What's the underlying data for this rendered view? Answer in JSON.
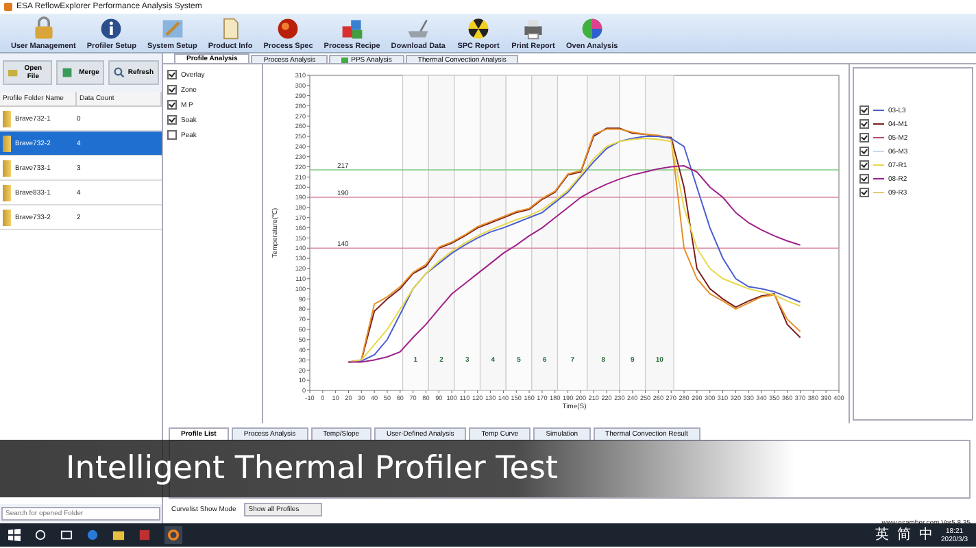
{
  "window": {
    "title": "ESA ReflowExplorer Performance Analysis System"
  },
  "toolbar": [
    "User Management",
    "Profiler Setup",
    "System Setup",
    "Product Info",
    "Process Spec",
    "Process Recipe",
    "Download Data",
    "SPC Report",
    "Print Report",
    "Oven  Analysis"
  ],
  "left_panel": {
    "buttons": [
      "Open File",
      "Merge",
      "Refresh"
    ],
    "table": {
      "columns": [
        "Profile Folder Name",
        "Data Count"
      ],
      "rows": [
        {
          "name": "Brave732-1",
          "count": "0",
          "selected": false
        },
        {
          "name": "Brave732-2",
          "count": "4",
          "selected": true
        },
        {
          "name": "Brave733-1",
          "count": "3",
          "selected": false
        },
        {
          "name": "Brave833-1",
          "count": "4",
          "selected": false
        },
        {
          "name": "Brave733-2",
          "count": "2",
          "selected": false
        }
      ]
    },
    "search": {
      "placeholder": "Search for opened Folder"
    }
  },
  "analysis_tabs": [
    {
      "label": "Profile Analysis",
      "selected": true
    },
    {
      "label": "Process Analysis",
      "selected": false
    },
    {
      "label": "PPS Analysis",
      "selected": false
    },
    {
      "label": "Thermal Convection Analysis",
      "selected": false
    }
  ],
  "options": [
    {
      "label": "Overlay",
      "checked": true
    },
    {
      "label": "Zone",
      "checked": true
    },
    {
      "label": "M P",
      "checked": true
    },
    {
      "label": "Soak",
      "checked": true
    },
    {
      "label": "Peak",
      "checked": false
    }
  ],
  "chart": {
    "chart_data": {
      "type": "line",
      "xlabel": "Time(S)",
      "ylabel": "Temperature(℃)",
      "xlim": [
        -10,
        400
      ],
      "ylim": [
        0,
        310
      ],
      "xticks": [
        -10,
        0,
        10,
        20,
        30,
        40,
        50,
        60,
        70,
        80,
        90,
        100,
        110,
        120,
        130,
        140,
        150,
        160,
        170,
        180,
        190,
        200,
        210,
        220,
        230,
        240,
        250,
        260,
        270,
        280,
        290,
        300,
        310,
        320,
        330,
        340,
        350,
        360,
        370,
        380,
        390,
        400
      ],
      "yticks": [
        0,
        10,
        20,
        30,
        40,
        50,
        60,
        70,
        80,
        90,
        100,
        110,
        120,
        130,
        140,
        150,
        160,
        170,
        180,
        190,
        200,
        210,
        220,
        230,
        240,
        250,
        260,
        270,
        280,
        290,
        300,
        310
      ],
      "x": [
        20,
        30,
        40,
        50,
        60,
        70,
        80,
        90,
        100,
        110,
        120,
        130,
        140,
        150,
        160,
        170,
        180,
        190,
        200,
        210,
        220,
        230,
        240,
        250,
        260,
        270,
        280,
        290,
        300,
        310,
        320,
        330,
        340,
        350,
        360,
        370
      ],
      "series": [
        {
          "color": "#7a1f1f",
          "values": [
            28,
            30,
            78,
            90,
            100,
            115,
            122,
            140,
            145,
            152,
            160,
            165,
            170,
            175,
            178,
            188,
            195,
            212,
            215,
            250,
            258,
            258,
            253,
            252,
            250,
            249,
            200,
            120,
            100,
            90,
            82,
            88,
            93,
            95,
            65,
            52
          ]
        },
        {
          "color": "#e8902a",
          "values": [
            null,
            31,
            85,
            92,
            102,
            116,
            124,
            141,
            146,
            153,
            161,
            166,
            171,
            176,
            179,
            189,
            196,
            213,
            216,
            252,
            257,
            257,
            254,
            252,
            251,
            248,
            140,
            110,
            95,
            88,
            80,
            86,
            92,
            94,
            70,
            58
          ]
        },
        {
          "color": "#4a5fd0",
          "values": [
            28,
            29,
            35,
            50,
            75,
            100,
            115,
            125,
            135,
            143,
            150,
            156,
            160,
            165,
            170,
            175,
            185,
            195,
            210,
            225,
            238,
            245,
            248,
            250,
            250,
            248,
            240,
            200,
            160,
            130,
            110,
            102,
            100,
            97,
            92,
            87
          ]
        },
        {
          "color": "#e8d84a",
          "values": [
            28,
            30,
            45,
            60,
            80,
            100,
            115,
            127,
            137,
            145,
            152,
            158,
            163,
            168,
            172,
            178,
            187,
            197,
            212,
            228,
            240,
            245,
            247,
            248,
            247,
            245,
            180,
            140,
            120,
            110,
            105,
            100,
            97,
            94,
            88,
            83
          ]
        },
        {
          "color": "#a0208a",
          "values": [
            28,
            28,
            30,
            33,
            38,
            52,
            65,
            80,
            95,
            105,
            115,
            125,
            135,
            143,
            152,
            160,
            170,
            180,
            190,
            197,
            203,
            208,
            212,
            215,
            218,
            220,
            221,
            215,
            200,
            190,
            175,
            165,
            158,
            152,
            147,
            143
          ]
        }
      ],
      "ref_lines": [
        {
          "axis": "y",
          "value": 217,
          "label": "217",
          "color": "#7fc87f"
        },
        {
          "axis": "y",
          "value": 190,
          "label": "190",
          "color": "#d98aa0"
        },
        {
          "axis": "y",
          "value": 140,
          "label": "140",
          "color": "#d98aa0"
        }
      ],
      "bands": [
        {
          "axis": "x",
          "from": 62,
          "to": 82,
          "label": "1"
        },
        {
          "axis": "x",
          "from": 82,
          "to": 102,
          "label": "2"
        },
        {
          "axis": "x",
          "from": 102,
          "to": 122,
          "label": "3"
        },
        {
          "axis": "x",
          "from": 122,
          "to": 142,
          "label": "4"
        },
        {
          "axis": "x",
          "from": 142,
          "to": 162,
          "label": "5"
        },
        {
          "axis": "x",
          "from": 162,
          "to": 182,
          "label": "6"
        },
        {
          "axis": "x",
          "from": 182,
          "to": 205,
          "label": "7"
        },
        {
          "axis": "x",
          "from": 205,
          "to": 230,
          "label": "8"
        },
        {
          "axis": "x",
          "from": 230,
          "to": 250,
          "label": "9"
        },
        {
          "axis": "x",
          "from": 250,
          "to": 272,
          "label": "10"
        }
      ]
    }
  },
  "legend": [
    {
      "label": "03-L3",
      "checked": true,
      "color": "#4a5fd0"
    },
    {
      "label": "04-M1",
      "checked": true,
      "color": "#7a1f1f"
    },
    {
      "label": "05-M2",
      "checked": true,
      "color": "#c04a6a"
    },
    {
      "label": "06-M3",
      "checked": true,
      "color": "#c8d8e8"
    },
    {
      "label": "07-R1",
      "checked": true,
      "color": "#e8d84a"
    },
    {
      "label": "08-R2",
      "checked": true,
      "color": "#a0208a"
    },
    {
      "label": "09-R3",
      "checked": true,
      "color": "#e8c86a"
    }
  ],
  "bottom_tabs": [
    {
      "label": "Profile List",
      "selected": true
    },
    {
      "label": "Process Analysis",
      "selected": false
    },
    {
      "label": "Temp/Slope",
      "selected": false
    },
    {
      "label": "User-Defined Analysis",
      "selected": false
    },
    {
      "label": "Temp Curve",
      "selected": false
    },
    {
      "label": "Simulation",
      "selected": false
    },
    {
      "label": "Thermal Convection Result",
      "selected": false
    }
  ],
  "curvelist": {
    "label": "Curvelist Show Mode",
    "value": "Show all Profiles"
  },
  "status_bar": "www.esamber.com Ver5.8.35",
  "caption": "Intelligent Thermal Profiler Test",
  "taskbar": {
    "tray_labels": [
      "英",
      "简"
    ],
    "ime": "中",
    "time": "18:21",
    "date": "2020/3/3"
  }
}
